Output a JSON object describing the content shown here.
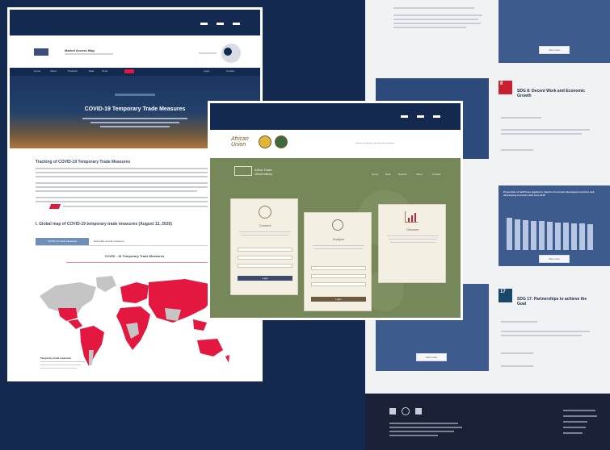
{
  "itc": {
    "site_name": "Market Access Map",
    "hero_title": "COVID-19 Temporary Trade Measures",
    "section_title": "Tracking of COVID-19 Temporary Trade Measures",
    "map_heading": "I. Global map of COVID-19 temporary trade measures (August 13, 2020)",
    "map_inner_title": "COVID - 19 Temporary Trade Measures",
    "tab_active": "COVID-19 Trade Measures",
    "tab_inactive": "Data table and all measures",
    "legend_title": "Temporary trade measures",
    "colors": {
      "navy": "#14294f",
      "measure_red": "#e3173f",
      "land_gray": "#c5c5c5"
    }
  },
  "au": {
    "brand_line1": "African",
    "brand_line2": "Union",
    "header_text": "Welcome to the African Trade Observatory Dashboard",
    "card_titles": [
      "Connect",
      "Analyze",
      "Discover"
    ],
    "card_button": "Login",
    "colors": {
      "green": "#76875a",
      "card": "#f3efe2"
    }
  },
  "sdg": {
    "card1_title": "SDG 8: Decent Work and Economic Growth",
    "card2_title": "SDG 17: Partnerships to achieve the Goal",
    "chart_title": "Proportion of tariff lines applied to imports from least developed countries and developing countries with zero-tariff",
    "card_label_8": "8",
    "card_label_17": "17",
    "colors": {
      "blue": "#3d5b8c",
      "red": "#c8202f"
    }
  }
}
